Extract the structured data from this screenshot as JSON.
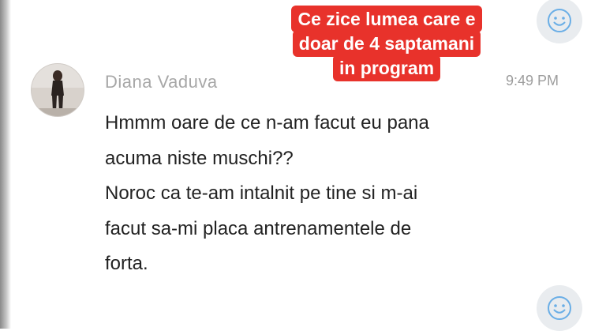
{
  "caption": {
    "lines": [
      "Ce zice lumea care e",
      "doar de 4 saptamani",
      "in program"
    ],
    "color": "#e8322b"
  },
  "message": {
    "sender": "Diana Vaduva",
    "time": "9:49 PM",
    "lines": [
      "Hmmm oare de ce n-am facut eu pana",
      "acuma niste muschi??",
      "Noroc ca te-am intalnit pe tine si m-ai",
      "facut sa-mi placa antrenamentele de",
      "forta."
    ]
  },
  "icons": {
    "reaction_top": "smiley-icon",
    "reaction_bottom": "smiley-icon",
    "accent": "#6aaee6"
  }
}
